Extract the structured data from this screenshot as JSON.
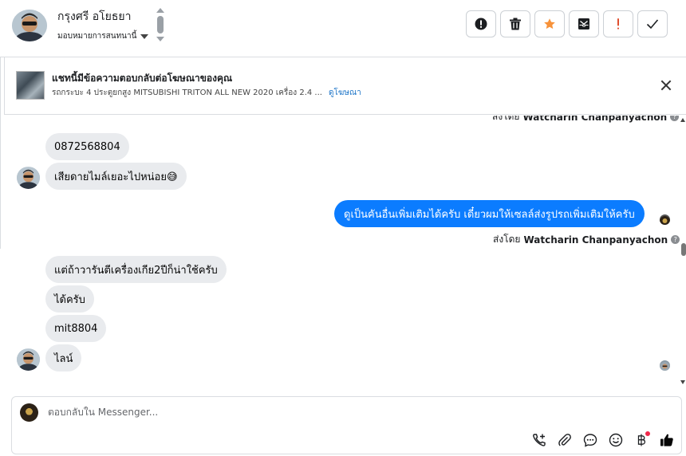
{
  "header": {
    "contact_name": "กรุงศรี อโยธยา",
    "assign_label": "มอบหมายการสนทนานี้",
    "actions": [
      {
        "icon": "alert-circle-icon",
        "name": "mark-spam-button"
      },
      {
        "icon": "trash-icon",
        "name": "delete-button"
      },
      {
        "icon": "star-icon",
        "name": "star-button"
      },
      {
        "icon": "mark-unread-icon",
        "name": "mark-unread-button"
      },
      {
        "icon": "exclamation-icon",
        "name": "flag-button"
      },
      {
        "icon": "check-icon",
        "name": "mark-done-button"
      }
    ],
    "star_color": "#f7923a",
    "flag_color": "#e04e2e"
  },
  "banner": {
    "title": "แชทนี้มีข้อความตอบกลับต่อโฆษณาของคุณ",
    "subtitle": "รถกระบะ 4 ประตูยกสูง MITSUBISHI TRITON ALL NEW 2020 เครื่อง 2.4 ...",
    "link": "ดูโฆษณา"
  },
  "messages": {
    "top_sent_by_prefix": "ส่งโดย",
    "top_sent_by_name": "Watcharin Chanpanyachon",
    "incoming_1": [
      "0872568804",
      "เสียดายไมล์เยอะไปหน่อย😅"
    ],
    "outgoing": "ดูเป็นคันอื่นเพิ่มเติมได้ครับ เดี๋ยวผมให้เซลล์ส่งรูปรถเพิ่มเติมให้ครับ",
    "sent_by_prefix": "ส่งโดย",
    "sent_by_name": "Watcharin Chanpanyachon",
    "incoming_2": [
      "แต่ถ้าวารันตีเครื่องเกีย2ปีก็น่าใช้ครับ",
      "ได้ครับ",
      "mit8804",
      "ไลน์"
    ],
    "outgoing_color": "#0b7cff",
    "incoming_color": "#e9ebee"
  },
  "composer": {
    "placeholder": "ตอบกลับใน Messenger...",
    "tools": [
      "phone-add-icon",
      "paperclip-icon",
      "chat-bubble-icon",
      "smiley-icon",
      "baht-icon",
      "thumbs-up-icon"
    ],
    "thumb_color": "#050505"
  }
}
